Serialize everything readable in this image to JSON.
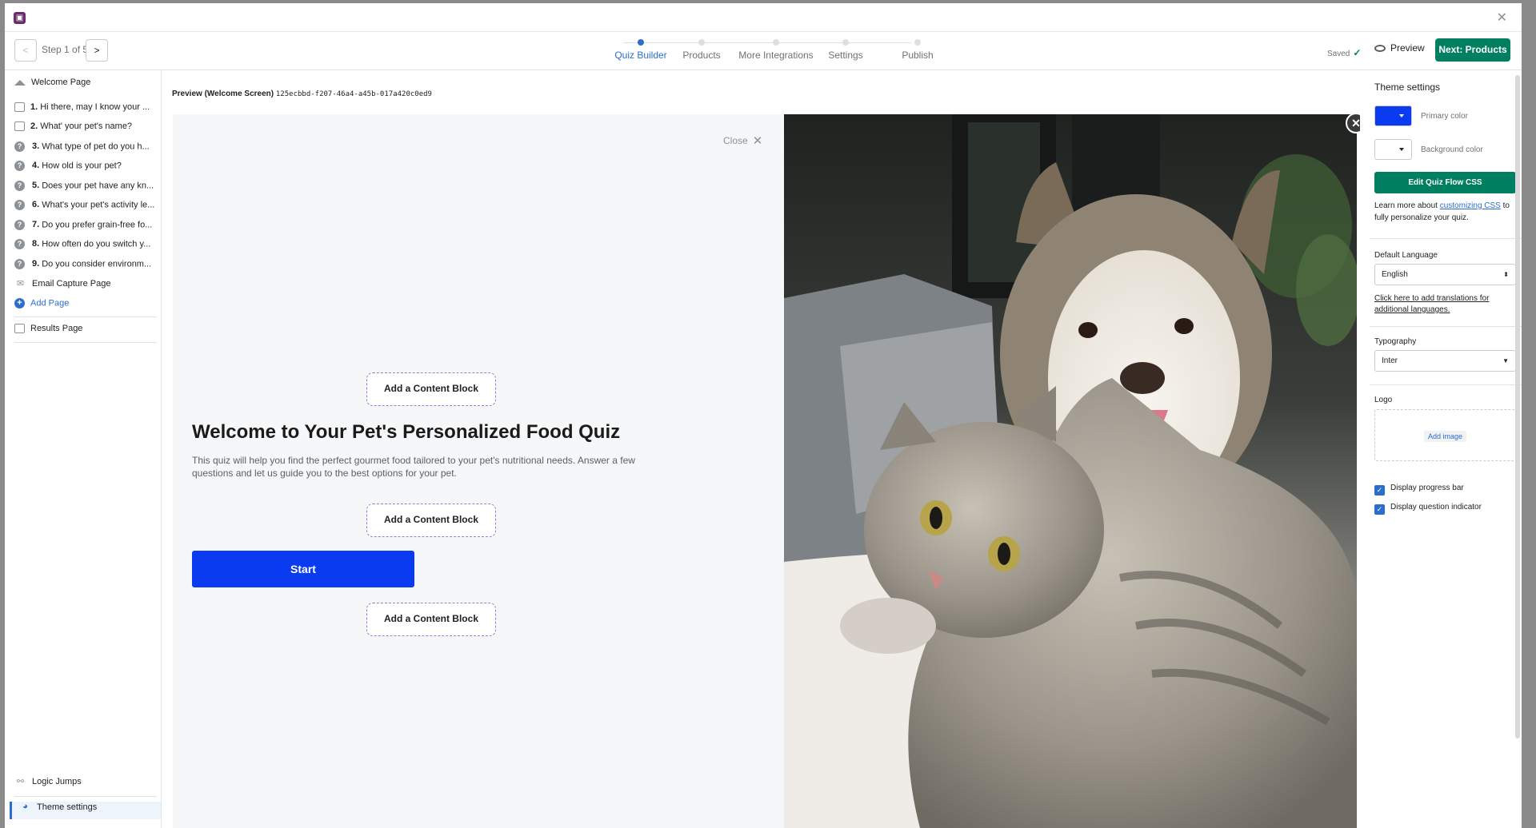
{
  "toolbar": {
    "step_text": "Step 1 of 5",
    "steps": [
      "Quiz Builder",
      "Products",
      "More Integrations",
      "Settings",
      "Publish"
    ],
    "saved": "Saved",
    "preview": "Preview",
    "next": "Next: Products"
  },
  "sidebar": {
    "welcome": "Welcome Page",
    "questions": [
      {
        "num": "1.",
        "text": "Hi there, may I know your ..."
      },
      {
        "num": "2.",
        "text": "What' your pet's name?"
      },
      {
        "num": "3.",
        "text": "What type of pet do you h..."
      },
      {
        "num": "4.",
        "text": "How old is your pet?"
      },
      {
        "num": "5.",
        "text": "Does your pet have any kn..."
      },
      {
        "num": "6.",
        "text": "What's your pet's activity le..."
      },
      {
        "num": "7.",
        "text": "Do you prefer grain-free fo..."
      },
      {
        "num": "8.",
        "text": "How often do you switch y..."
      },
      {
        "num": "9.",
        "text": "Do you consider environm..."
      }
    ],
    "email": "Email Capture Page",
    "add_page": "Add Page",
    "results": "Results Page",
    "logic": "Logic Jumps",
    "theme": "Theme settings"
  },
  "main": {
    "preview_label": "Preview (Welcome Screen)",
    "preview_id": "125ecbbd-f207-46a4-a45b-017a420c0ed9",
    "close": "Close",
    "content_block": "Add a Content Block",
    "title": "Welcome to Your Pet's Personalized Food Quiz",
    "description": "This quiz will help you find the perfect gourmet food tailored to your pet's nutritional needs. Answer a few questions and let us guide you to the best options for your pet.",
    "start": "Start"
  },
  "theme": {
    "title": "Theme settings",
    "primary_label": "Primary color",
    "primary_color": "#0b3bf0",
    "background_label": "Background color",
    "background_color": "#ffffff",
    "edit_css": "Edit Quiz Flow CSS",
    "css_note_pre": "Learn more about ",
    "css_note_link": "customizing CSS",
    "css_note_post": " to fully personalize your quiz.",
    "language_label": "Default Language",
    "language_value": "English",
    "translations_link": "Click here to add translations for additional languages.",
    "typography_label": "Typography",
    "typography_value": "Inter",
    "logo_label": "Logo",
    "add_image": "Add image",
    "progress_bar": "Display progress bar",
    "question_indicator": "Display question indicator"
  }
}
